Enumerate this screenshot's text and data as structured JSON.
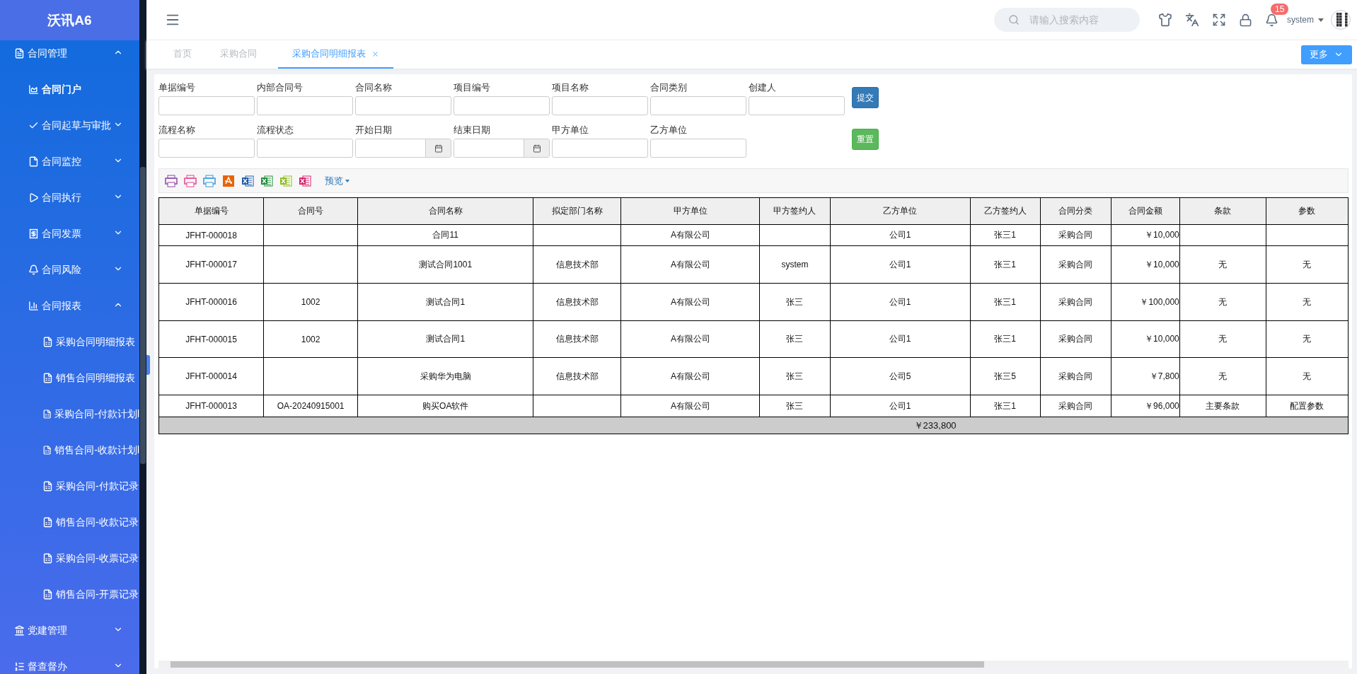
{
  "app_title": "沃讯A6",
  "sidebar": {
    "items": [
      {
        "label": "合同管理",
        "expanded": true,
        "children": [
          {
            "label": "合同门户",
            "kind": "link",
            "selected": true
          },
          {
            "label": "合同起草与审批",
            "kind": "menu",
            "selected": false,
            "expanded": false
          },
          {
            "label": "合同监控",
            "kind": "menu",
            "selected": false,
            "expanded": false
          },
          {
            "label": "合同执行",
            "kind": "menu",
            "selected": false,
            "expanded": false
          },
          {
            "label": "合同发票",
            "kind": "menu",
            "selected": false,
            "expanded": false
          },
          {
            "label": "合同风险",
            "kind": "menu",
            "selected": false,
            "expanded": false
          },
          {
            "label": "合同报表",
            "kind": "menu",
            "selected": false,
            "expanded": true,
            "children": [
              {
                "label": "采购合同明细报表"
              },
              {
                "label": "销售合同明细报表"
              },
              {
                "label": "采购合同-付款计划l"
              },
              {
                "label": "销售合同-收款计划l"
              },
              {
                "label": "采购合同-付款记录"
              },
              {
                "label": "销售合同-收款记录"
              },
              {
                "label": "采购合同-收票记录"
              },
              {
                "label": "销售合同-开票记录"
              }
            ]
          }
        ]
      },
      {
        "label": "党建管理",
        "expanded": false
      },
      {
        "label": "督查督办",
        "expanded": false
      }
    ]
  },
  "header": {
    "search": {
      "placeholder": "请输入搜索内容"
    },
    "notification_count": "15",
    "user": "system"
  },
  "tabs": [
    {
      "label": "首页",
      "selected": false,
      "closable": false
    },
    {
      "label": "采购合同",
      "selected": false,
      "closable": false
    },
    {
      "label": "采购合同明细报表",
      "selected": true,
      "closable": true
    }
  ],
  "more_button": "更多",
  "filters": {
    "rows": [
      [
        {
          "label": "单据编号",
          "kind": "text"
        },
        {
          "label": "内部合同号",
          "kind": "text"
        },
        {
          "label": "合同名称",
          "kind": "text"
        },
        {
          "label": "项目编号",
          "kind": "text"
        },
        {
          "label": "项目名称",
          "kind": "text"
        },
        {
          "label": "合同类别",
          "kind": "text"
        },
        {
          "label": "创建人",
          "kind": "text"
        }
      ],
      [
        {
          "label": "流程名称",
          "kind": "text"
        },
        {
          "label": "流程状态",
          "kind": "text"
        },
        {
          "label": "开始日期",
          "kind": "date"
        },
        {
          "label": "结束日期",
          "kind": "date"
        },
        {
          "label": "甲方单位",
          "kind": "text"
        },
        {
          "label": "乙方单位",
          "kind": "text"
        }
      ]
    ],
    "buttons": [
      {
        "label": "提交",
        "kind": "primary"
      },
      {
        "label": "重置",
        "kind": "success"
      }
    ]
  },
  "toolbar": {
    "preview": "预览"
  },
  "table": {
    "columns": [
      "单据编号",
      "合同号",
      "合同名称",
      "拟定部门名称",
      "甲方单位",
      "甲方签约人",
      "乙方单位",
      "乙方签约人",
      "合同分类",
      "合同金额",
      "条款",
      "参数"
    ],
    "rows": [
      [
        "JFHT-000018",
        null,
        "合同11",
        null,
        "A有限公司",
        null,
        "公司1",
        "张三1",
        "采购合同",
        "￥10,000",
        null,
        null
      ],
      [
        "JFHT-000017",
        null,
        "测试合同1001",
        "信息技术部",
        "A有限公司",
        "system",
        "公司1",
        "张三1",
        "采购合同",
        "￥10,000",
        "无",
        "无"
      ],
      [
        "JFHT-000016",
        "1002",
        "测试合同1",
        "信息技术部",
        "A有限公司",
        "张三",
        "公司1",
        "张三1",
        "采购合同",
        "￥100,000",
        "无",
        "无"
      ],
      [
        "JFHT-000015",
        "1002",
        "测试合同1",
        "信息技术部",
        "A有限公司",
        "张三",
        "公司1",
        "张三1",
        "采购合同",
        "￥10,000",
        "无",
        "无"
      ],
      [
        "JFHT-000014",
        null,
        "采购华为电脑",
        "信息技术部",
        "A有限公司",
        "张三",
        "公司5",
        "张三5",
        "采购合同",
        "￥7,800",
        "无",
        "无"
      ],
      [
        "JFHT-000013",
        "OA-20240915001",
        "购买OA软件",
        null,
        "A有限公司",
        "张三",
        "公司1",
        "张三1",
        "采购合同",
        "￥96,000",
        "主要条款",
        "配置参数"
      ]
    ],
    "total": "￥233,800"
  }
}
